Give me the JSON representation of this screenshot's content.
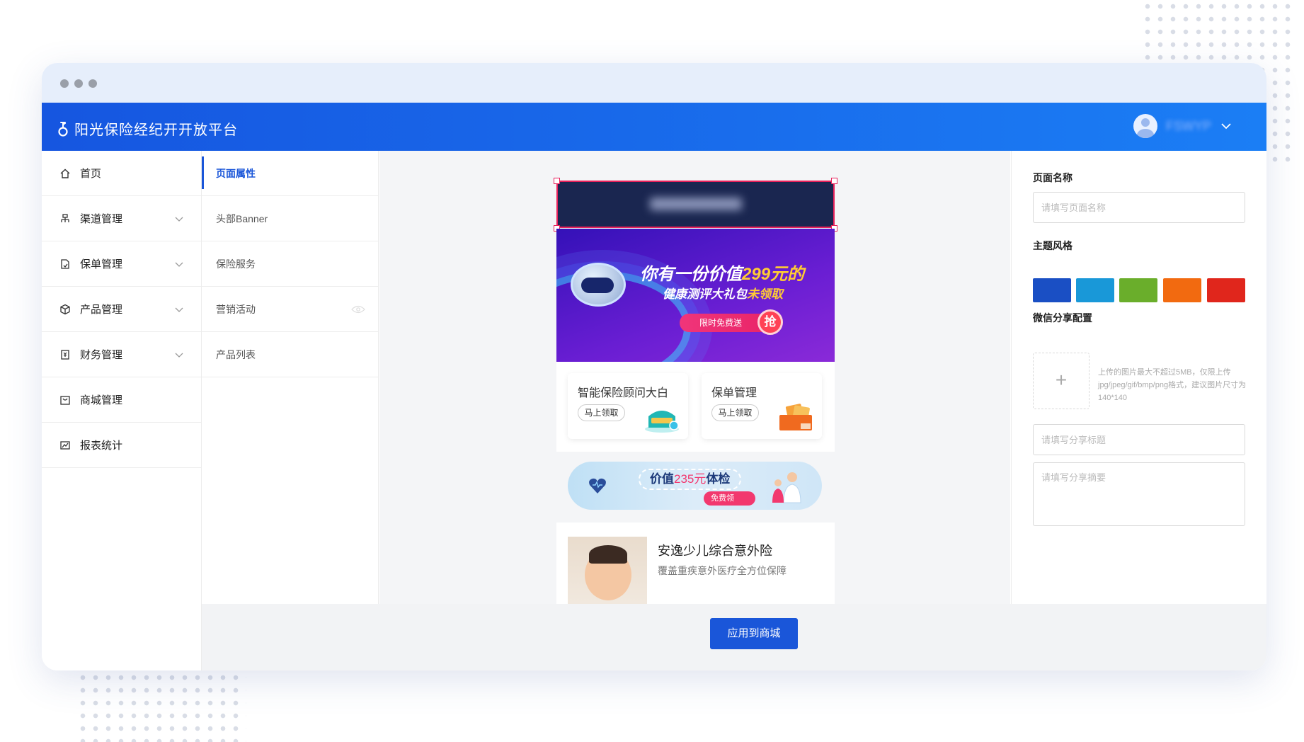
{
  "app": {
    "title": "阳光保险经纪开开放平台",
    "username": "FSWYP"
  },
  "sidebar": {
    "items": [
      {
        "label": "首页"
      },
      {
        "label": "渠道管理"
      },
      {
        "label": "保单管理"
      },
      {
        "label": "产品管理"
      },
      {
        "label": "财务管理"
      },
      {
        "label": "商城管理"
      },
      {
        "label": "报表统计"
      }
    ]
  },
  "subnav": {
    "items": [
      {
        "label": "页面属性"
      },
      {
        "label": "头部Banner"
      },
      {
        "label": "保险服务"
      },
      {
        "label": "营销活动"
      },
      {
        "label": "产品列表"
      }
    ]
  },
  "preview": {
    "banner": {
      "line1_prefix": "你有一份价值",
      "line1_amount": "299元的",
      "line2_prefix": "健康测评大礼包",
      "line2_highlight": "未领取",
      "pill_label": "限时免费送",
      "grab_label": "抢"
    },
    "services": [
      {
        "title": "智能保险顾问大白",
        "button": "马上领取"
      },
      {
        "title": "保单管理",
        "button": "马上领取"
      }
    ],
    "promo": {
      "prefix": "价值",
      "amount": "235元",
      "suffix": "体检",
      "free_label": "免费领"
    },
    "product": {
      "name": "安逸少儿综合意外险",
      "desc": "覆盖重疾意外医疗全方位保障"
    }
  },
  "props": {
    "page_name_label": "页面名称",
    "page_name_placeholder": "请填写页面名称",
    "theme_label": "主题风格",
    "theme_colors": [
      "#1a4fc4",
      "#1998d8",
      "#6aae2b",
      "#f26a10",
      "#e0261c"
    ],
    "wechat_label": "微信分享配置",
    "upload_hint": "上传的图片最大不超过5MB，仅限上传jpg/jpeg/gif/bmp/png格式，建议图片尺寸为140*140",
    "share_title_placeholder": "请填写分享标题",
    "share_desc_placeholder": "请填写分享摘要"
  },
  "actions": {
    "apply_label": "应用到商城"
  },
  "colors": {
    "primary": "#1a56d9",
    "appbar_start": "#1656e0",
    "appbar_end": "#1b7ef5",
    "selection": "#e7215b"
  }
}
